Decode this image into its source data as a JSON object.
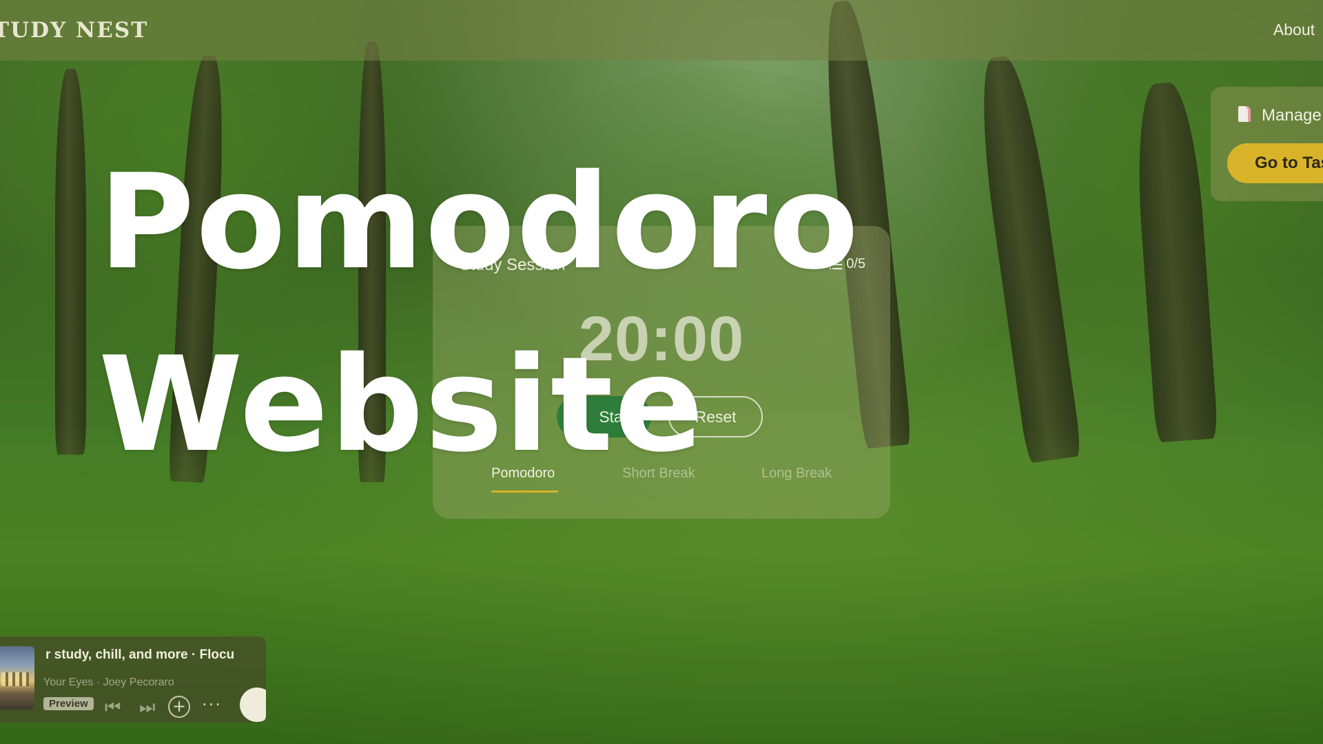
{
  "nav": {
    "brand": "TUDY NEST",
    "about_label": "About"
  },
  "tasks_card": {
    "manage_label": "Manage T",
    "go_button_label": "Go to Tas",
    "icon": "document-icon"
  },
  "hero": {
    "line1": "Pomodoro",
    "line2": "Website"
  },
  "timer": {
    "session_title": "Study Session",
    "session_count": "0/5",
    "display": "20:00",
    "start_label": "Start",
    "reset_label": "Reset",
    "tabs": [
      {
        "label": "Pomodoro",
        "active": true
      },
      {
        "label": "Short Break",
        "active": false
      },
      {
        "label": "Long Break",
        "active": false
      }
    ]
  },
  "player": {
    "playlist_title": "r study, chill, and more · Flocu",
    "track": "Your Eyes",
    "artist": "Joey Pecoraro",
    "track_line": "Your Eyes  ·  Joey Pecoraro",
    "preview_label": "Preview"
  },
  "colors": {
    "accent_gold": "#d9b32a",
    "start_green": "#2e7d3a"
  }
}
